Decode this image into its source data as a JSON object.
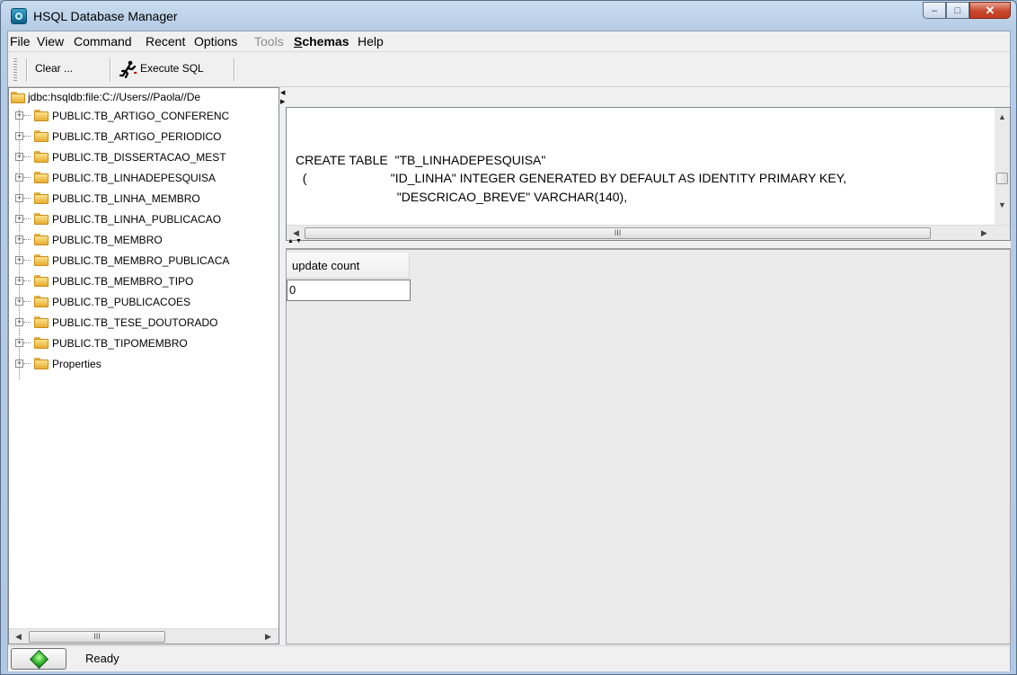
{
  "window": {
    "title": "HSQL Database Manager",
    "minimize": "–",
    "maximize": "□",
    "close": "✕"
  },
  "menu": {
    "file": "File",
    "view": "View",
    "command": "Command",
    "recent": "Recent",
    "options": "Options",
    "tools": "Tools",
    "schemas_mnemonic": "S",
    "schemas_rest": "chemas",
    "help": "Help"
  },
  "toolbar": {
    "clear": "Clear ...",
    "execute": "Execute SQL"
  },
  "tree": {
    "root": "jdbc:hsqldb:file:C://Users//Paola//De",
    "items": [
      "PUBLIC.TB_ARTIGO_CONFERENC",
      "PUBLIC.TB_ARTIGO_PERIODICO",
      "PUBLIC.TB_DISSERTACAO_MEST",
      "PUBLIC.TB_LINHADEPESQUISA",
      "PUBLIC.TB_LINHA_MEMBRO",
      "PUBLIC.TB_LINHA_PUBLICACAO",
      "PUBLIC.TB_MEMBRO",
      "PUBLIC.TB_MEMBRO_PUBLICACA",
      "PUBLIC.TB_MEMBRO_TIPO",
      "PUBLIC.TB_PUBLICACOES",
      "PUBLIC.TB_TESE_DOUTORADO",
      "PUBLIC.TB_TIPOMEMBRO",
      "Properties"
    ],
    "expander": "+"
  },
  "editor": {
    "lines": [
      "CREATE TABLE  \"TB_LINHADEPESQUISA\"",
      "  (                        \"ID_LINHA\" INTEGER GENERATED BY DEFAULT AS IDENTITY PRIMARY KEY,",
      "                             \"DESCRICAO_BREVE\" VARCHAR(140),"
    ]
  },
  "scroll": {
    "left": "◀",
    "right": "▶",
    "up": "▲",
    "down": "▼",
    "thumb": "III"
  },
  "results": {
    "column": "update count",
    "value": "0"
  },
  "status": {
    "text": "Ready",
    "color": "#2fb22a"
  }
}
